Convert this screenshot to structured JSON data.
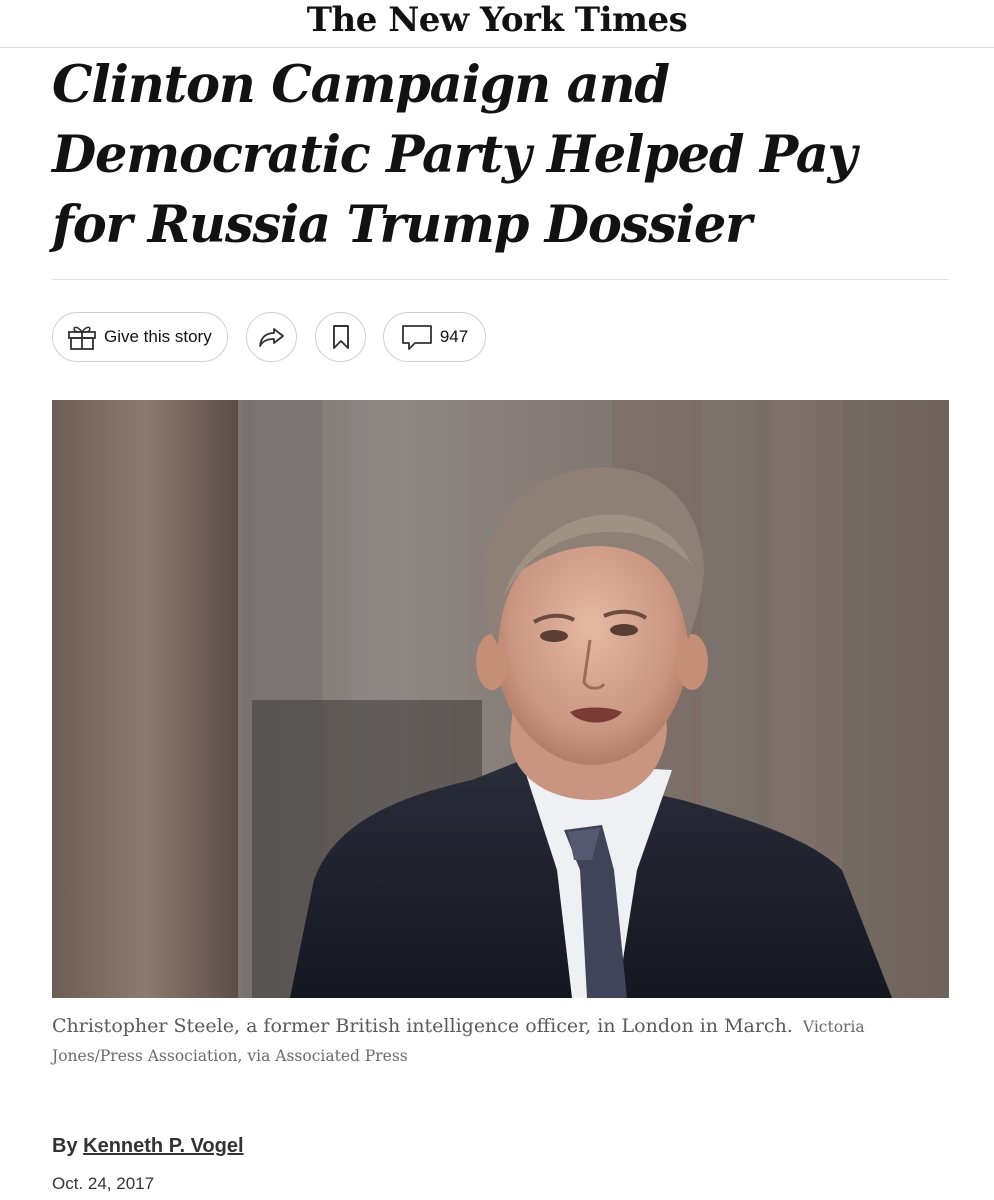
{
  "masthead": {
    "logo_text": "The New York Times"
  },
  "article": {
    "headline": "Clinton Campaign and Democratic Party Helped Pay for Russia Trump Dossier",
    "actions": {
      "gift_label": "Give this story",
      "comment_count": "947"
    },
    "photo": {
      "caption": "Christopher Steele, a former British intelligence officer, in London in March.",
      "credit": "Victoria Jones/Press Association, via Associated Press"
    },
    "byline": {
      "prefix": "By",
      "author": "Kenneth P. Vogel"
    },
    "date": "Oct. 24, 2017"
  },
  "icons": {
    "gift": "gift-icon",
    "share": "share-icon",
    "save": "bookmark-icon",
    "comments": "comment-icon"
  },
  "colors": {
    "text": "#121212",
    "caption": "#5a5a5a",
    "border": "#cfcfcf",
    "rule": "#e2e2e2"
  }
}
